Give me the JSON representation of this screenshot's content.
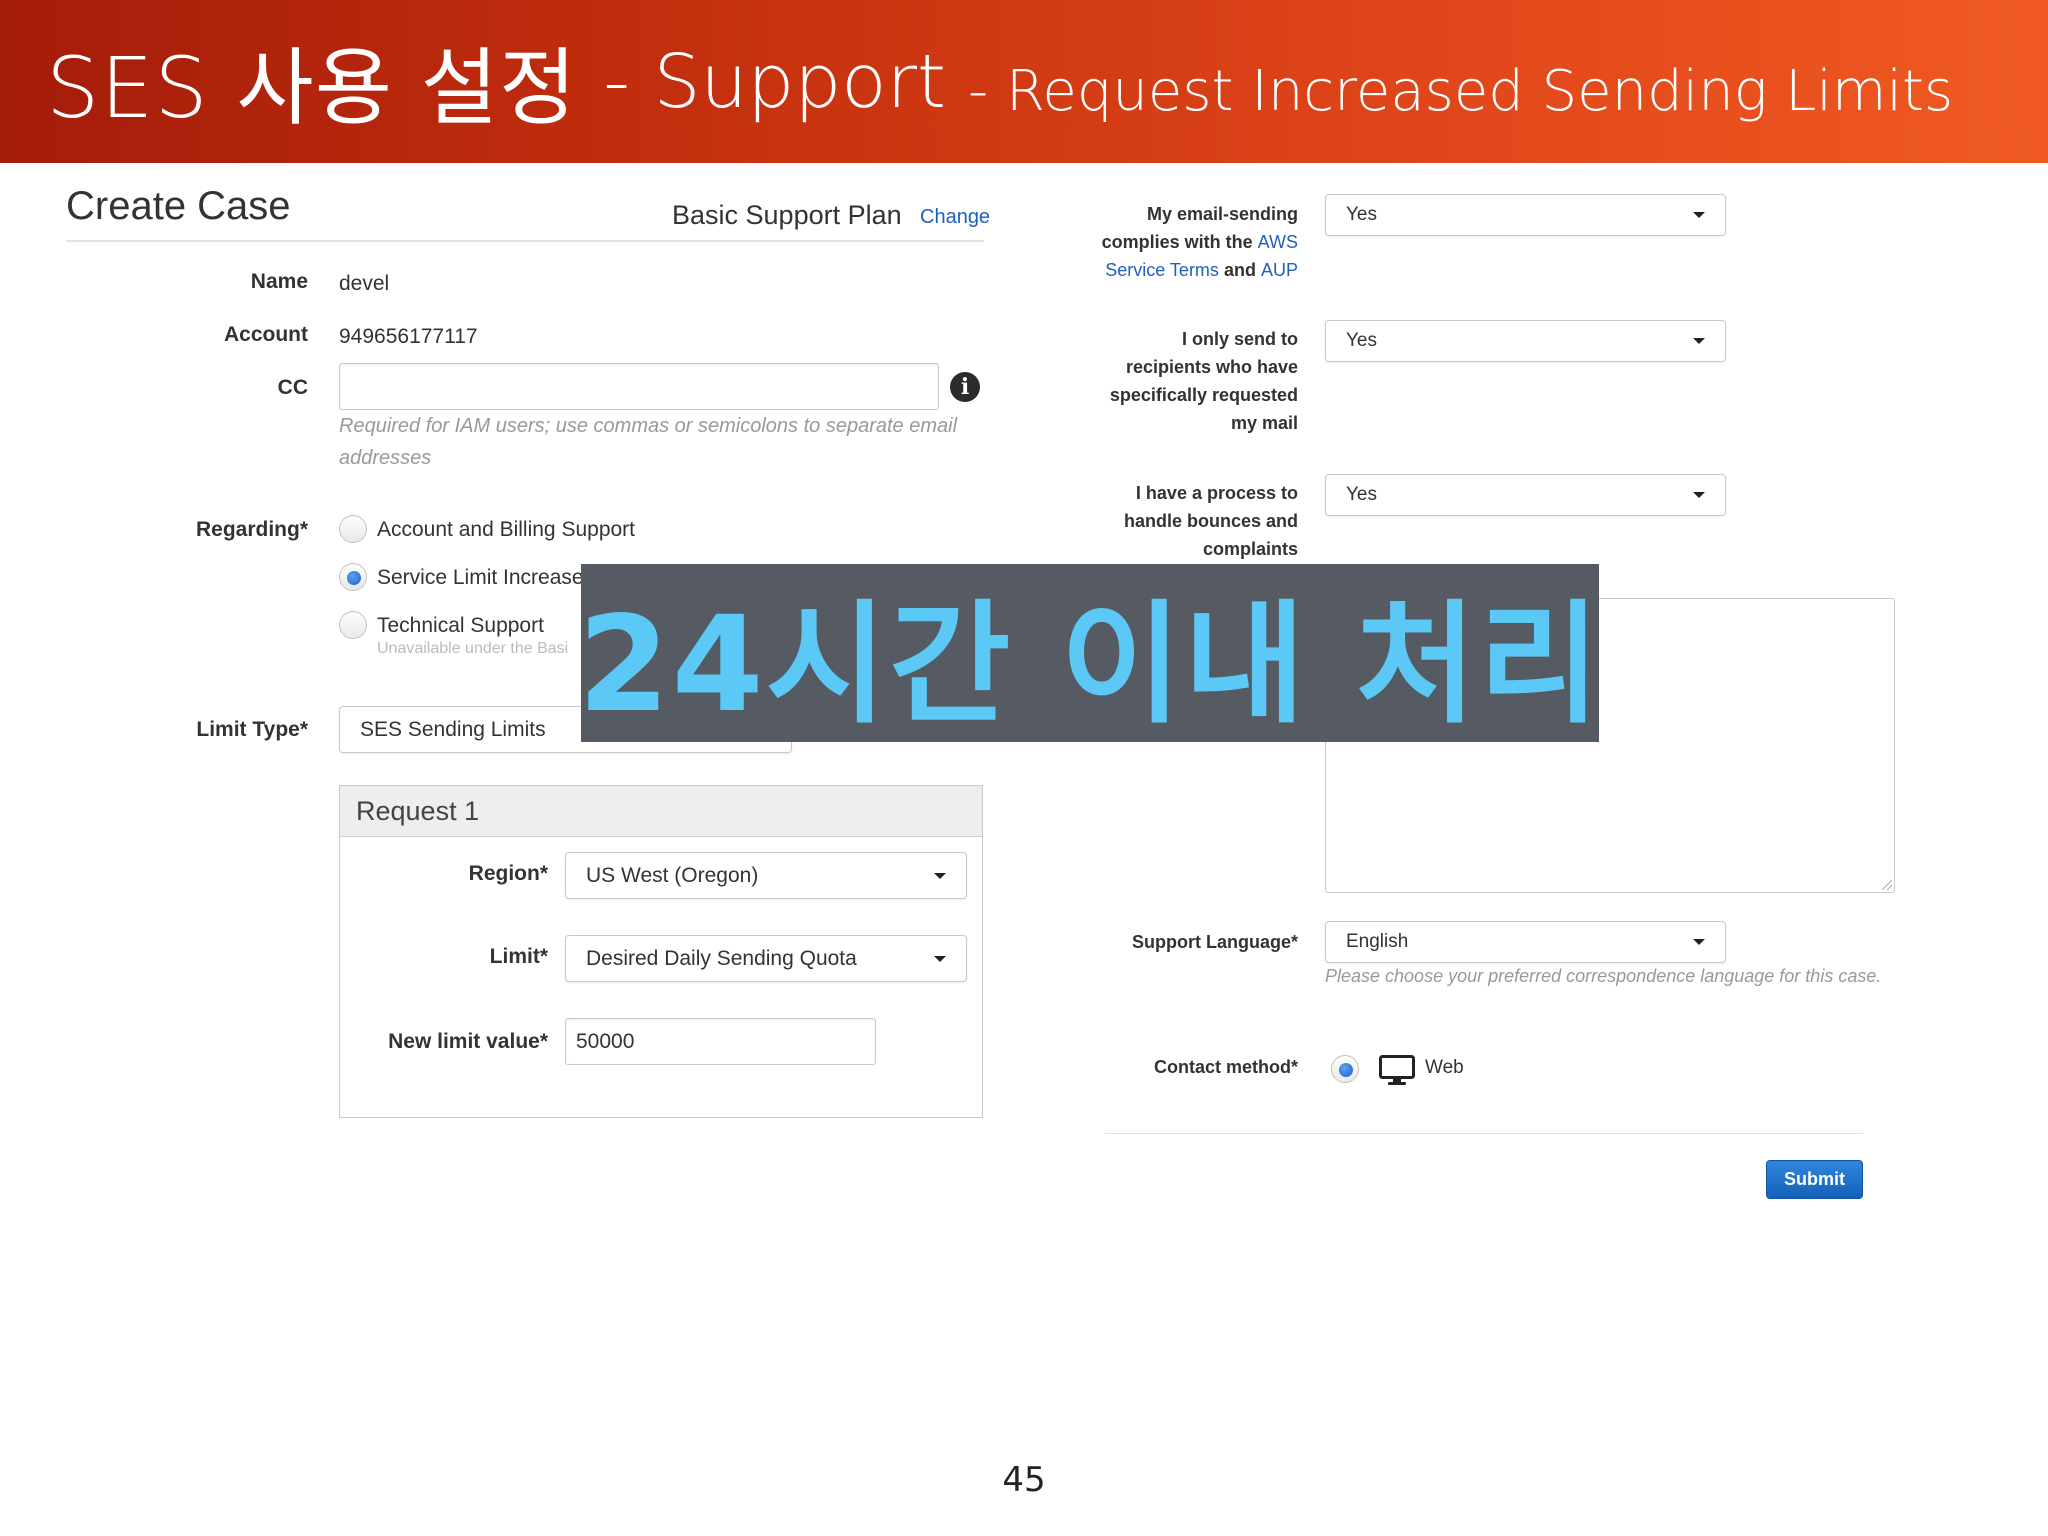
{
  "slide": {
    "title_main": "SES 사용 설정",
    "title_sep": "- Support",
    "title_sub": "- Request Increased Sending Limits",
    "page_number": "45",
    "overlay_banner": "24시간 이내 처리"
  },
  "case": {
    "title": "Create Case",
    "plan": "Basic Support Plan",
    "change_link": "Change",
    "name_label": "Name",
    "name_value": "devel",
    "account_label": "Account",
    "account_value": "949656177117",
    "cc_label": "CC",
    "cc_value": "",
    "cc_hint": "Required for IAM users; use commas or semicolons to separate email addresses",
    "regarding_label": "Regarding*",
    "regarding_options": [
      {
        "label": "Account and Billing Support",
        "selected": false
      },
      {
        "label": "Service Limit Increase",
        "selected": true
      },
      {
        "label": "Technical Support",
        "selected": false,
        "note": "Unavailable under the Basi"
      }
    ],
    "limit_type_label": "Limit Type*",
    "limit_type_value": "SES Sending Limits"
  },
  "request": {
    "title": "Request 1",
    "region_label": "Region*",
    "region_value": "US West (Oregon)",
    "limit_label": "Limit*",
    "limit_value": "Desired Daily Sending Quota",
    "new_limit_label": "New limit value*",
    "new_limit_value": "50000"
  },
  "compliance": {
    "q1_label_a": "My email-sending",
    "q1_label_b": "complies with the",
    "q1_link_aws": "AWS",
    "q1_link_terms": "Service Terms",
    "q1_and": "and",
    "q1_link_aup": "AUP",
    "q1_value": "Yes",
    "q2_label": [
      "I only send to",
      "recipients who have",
      "specifically requested",
      "my mail"
    ],
    "q2_value": "Yes",
    "q3_label": [
      "I have a process to",
      "handle bounces and",
      "complaints"
    ],
    "q3_value": "Yes"
  },
  "contact": {
    "language_label": "Support Language*",
    "language_value": "English",
    "language_hint": "Please choose your preferred correspondence language for this case.",
    "method_label": "Contact method*",
    "method_value": "Web",
    "submit_label": "Submit"
  },
  "icons": {
    "info": "info-icon",
    "monitor": "monitor-icon",
    "caret": "chevron-down-icon"
  },
  "colors": {
    "header_start": "#a41c0a",
    "header_end": "#f05a22",
    "link": "#1f5fbf",
    "submit": "#1f72cc",
    "banner_bg": "#565b63",
    "banner_text": "#5bc8f5"
  }
}
